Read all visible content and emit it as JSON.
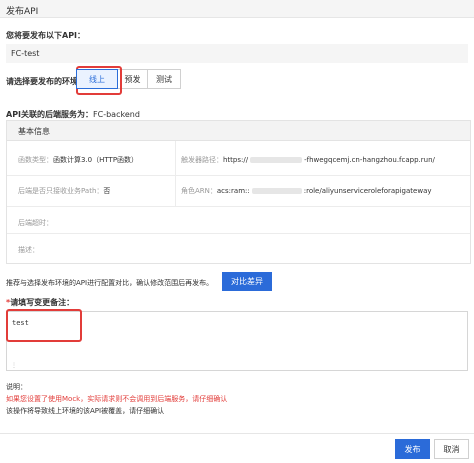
{
  "dialog": {
    "title": "发布API"
  },
  "api_section": {
    "label": "您将要发布以下API：",
    "api_name": "FC-test"
  },
  "env_section": {
    "label": "请选择要发布的环境：",
    "options": [
      {
        "label": "线上",
        "selected": true
      },
      {
        "label": "预发",
        "selected": false
      },
      {
        "label": "测试",
        "selected": false
      }
    ]
  },
  "backend_section": {
    "label": "API关联的后端服务为：",
    "value": "FC-backend"
  },
  "basic_info": {
    "title": "基本信息",
    "function_type_label": "函数类型：",
    "function_type_value": "函数计算3.0（HTTP函数）",
    "trigger_path_label": "触发器路径：",
    "trigger_path_prefix": "https://",
    "trigger_path_suffix": "-fhwegqcemj.cn-hangzhou.fcapp.run/",
    "path_label": "后端是否只接收业务Path：",
    "path_value": "否",
    "role_label": "角色ARN：",
    "role_prefix": "acs:ram::",
    "role_suffix": ":role/aliyunserviceroleforapigateway",
    "timeout_label": "后端超时：",
    "desc_label": "描述："
  },
  "compare": {
    "hint": "推荐与选择发布环境的API进行配置对比，确认修改范围后再发布。",
    "button": "对比差异"
  },
  "note": {
    "required_mark": "*",
    "label": "请填写变更备注：",
    "value": "test"
  },
  "explanation": {
    "label": "说明：",
    "warning": "如果您设置了使用Mock，实际请求则不会调用到后端服务，请仔细确认",
    "info": "该操作将导致线上环境的该API被覆盖，请仔细确认"
  },
  "footer": {
    "publish": "发布",
    "cancel": "取消"
  },
  "colors": {
    "primary": "#2b6bd9",
    "highlight": "#e23c39",
    "warning_text": "#e23c39"
  }
}
